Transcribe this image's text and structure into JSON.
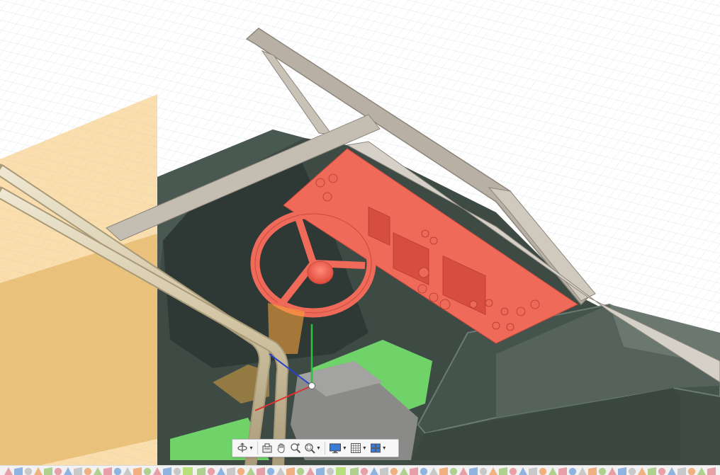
{
  "viewport": {
    "grid_color": "#d7dce2",
    "colors": {
      "body": "#3e4b45",
      "body_light": "#55635c",
      "frame": "#b8b0a4",
      "dashboard": "#f06a5a",
      "dashboard_dark": "#d74d40",
      "floor": "#6fd36a",
      "construction_plane": "#f5c26b",
      "tubing": "#d2c6a8"
    },
    "axes": {
      "x": "#e03030",
      "y": "#2ec040",
      "z": "#2a40d0"
    }
  },
  "nav_toolbar": {
    "tools": [
      {
        "name": "orbit-icon",
        "has_menu": true
      },
      {
        "name": "look-at-icon",
        "has_menu": false
      },
      {
        "name": "pan-hand-icon",
        "has_menu": false
      },
      {
        "name": "zoom-icon",
        "has_menu": false
      },
      {
        "name": "fit-zoom-icon",
        "has_menu": true
      },
      {
        "name": "display-settings-icon",
        "has_menu": true
      },
      {
        "name": "grid-settings-icon",
        "has_menu": true
      },
      {
        "name": "viewports-icon",
        "has_menu": true
      }
    ]
  },
  "timeline": {
    "feature_colors": [
      "#e8a0a8",
      "#8fb4e0",
      "#c8c8c8",
      "#f0b080",
      "#b0d090"
    ],
    "marker_color": "#b7e07d"
  }
}
